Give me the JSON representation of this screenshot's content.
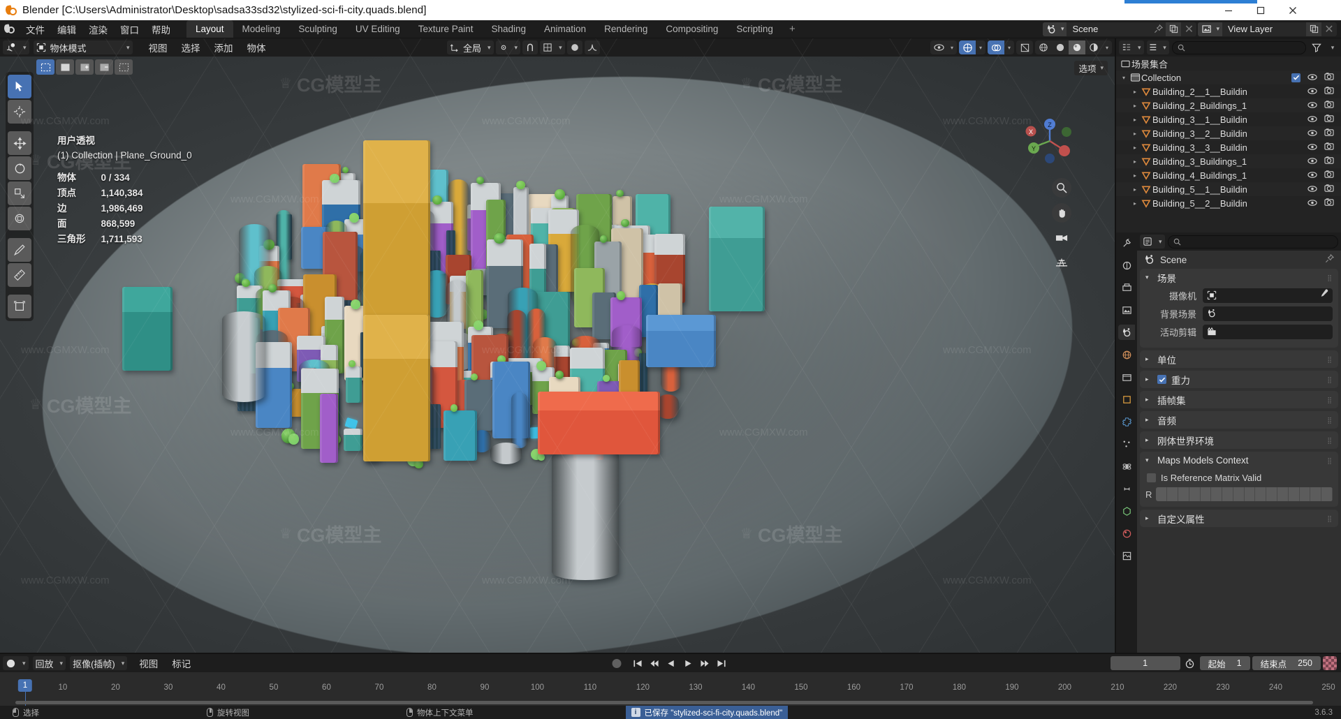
{
  "window": {
    "title": "Blender [C:\\Users\\Administrator\\Desktop\\sadsa33sd32\\stylized-sci-fi-city.quads.blend]",
    "minimize": "–",
    "maximize": "□",
    "close": "✕"
  },
  "topbar": {
    "menus": [
      "文件",
      "编辑",
      "渲染",
      "窗口",
      "帮助"
    ],
    "workspaces": [
      "Layout",
      "Modeling",
      "Sculpting",
      "UV Editing",
      "Texture Paint",
      "Shading",
      "Animation",
      "Rendering",
      "Compositing",
      "Scripting"
    ],
    "active_workspace": "Layout",
    "add_workspace": "+",
    "scene_name": "Scene",
    "view_layer_name": "View Layer"
  },
  "viewport": {
    "mode": "物体模式",
    "menus": [
      "视图",
      "选择",
      "添加",
      "物体"
    ],
    "transform_orientation": "全局",
    "options_label": "选项",
    "overlay_header": "用户透视",
    "overlay_subheader": "(1) Collection | Plane_Ground_0",
    "stats": [
      {
        "label": "物体",
        "value": "0 / 334"
      },
      {
        "label": "顶点",
        "value": "1,140,384"
      },
      {
        "label": "边",
        "value": "1,986,469"
      },
      {
        "label": "面",
        "value": "868,599"
      },
      {
        "label": "三角形",
        "value": "1,711,593"
      }
    ],
    "gizmo_axes": [
      "X",
      "Y",
      "Z"
    ]
  },
  "outliner": {
    "search_placeholder": "",
    "scene_collection": "场景集合",
    "root": "Collection",
    "items": [
      "Building_2__1__Buildin",
      "Building_2_Buildings_1",
      "Building_3__1__Buildin",
      "Building_3__2__Buildin",
      "Building_3__3__Buildin",
      "Building_3_Buildings_1",
      "Building_4_Buildings_1",
      "Building_5__1__Buildin",
      "Building_5__2__Buildin"
    ]
  },
  "properties": {
    "breadcrumb": "Scene",
    "search_placeholder": "",
    "panels": [
      {
        "id": "scene",
        "label": "场景",
        "open": true
      },
      {
        "id": "units",
        "label": "单位",
        "open": false
      },
      {
        "id": "gravity",
        "label": "重力",
        "open": false,
        "checkbox": true
      },
      {
        "id": "keying",
        "label": "插帧集",
        "open": false
      },
      {
        "id": "audio",
        "label": "音频",
        "open": false
      },
      {
        "id": "rigid",
        "label": "刚体世界环境",
        "open": false
      },
      {
        "id": "maps",
        "label": "Maps Models Context",
        "open": true
      },
      {
        "id": "custom",
        "label": "自定义属性",
        "open": false
      }
    ],
    "scene_fields": [
      {
        "label": "摄像机",
        "value": "",
        "icon": "camera-icon"
      },
      {
        "label": "背景场景",
        "value": "",
        "icon": "scene-icon"
      },
      {
        "label": "活动剪辑",
        "value": "",
        "icon": "clip-icon"
      }
    ],
    "maps_fields": {
      "checkbox_label": "Is Reference Matrix Valid",
      "checkbox_checked": false,
      "matrix_label": "R"
    }
  },
  "timeline": {
    "playback_label": "回放",
    "keying_label": "抠像(插帧)",
    "menus": [
      "视图",
      "标记"
    ],
    "current_frame": "1",
    "start_label": "起始",
    "start_value": "1",
    "end_label": "结束点",
    "end_value": "250",
    "ticks": [
      1,
      10,
      20,
      30,
      40,
      50,
      60,
      70,
      80,
      90,
      100,
      110,
      120,
      130,
      140,
      150,
      160,
      170,
      180,
      190,
      200,
      210,
      220,
      230,
      240,
      250
    ],
    "playhead_label": "1"
  },
  "statusbar": {
    "hints": [
      {
        "mouse": "left",
        "label": "选择"
      },
      {
        "mouse": "middle",
        "label": "旋转视图"
      },
      {
        "mouse": "right",
        "label": "物体上下文菜单"
      }
    ],
    "message": "已保存 \"stylized-sci-fi-city.quads.blend\"",
    "version": "3.6.3"
  },
  "watermarks": {
    "small": "www.CGMXW.com",
    "brand": "CG模型主"
  },
  "colors": {
    "accent_blue": "#4772b3",
    "outliner_orange": "#e08a3c",
    "editor_bg": "#303030",
    "header_bg": "#1d1d1d",
    "viewport_bg": "#393939"
  }
}
